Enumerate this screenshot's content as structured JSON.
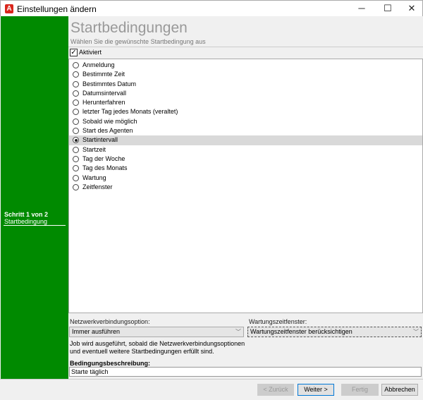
{
  "window": {
    "title": "Einstellungen ändern",
    "icon": "A",
    "minimize": "─",
    "maximize": "☐",
    "close": "✕"
  },
  "sidebar": {
    "step": "Schritt 1 von 2",
    "step_name": "Startbedingung",
    "color": "#008a00"
  },
  "header": {
    "title": "Startbedingungen",
    "subtitle": "Wählen Sie die gewünschte Startbedingung aus"
  },
  "enabled": {
    "label": "Aktiviert",
    "checked": true
  },
  "conditions": [
    {
      "label": "Anmeldung",
      "selected": false
    },
    {
      "label": "Bestimmte Zeit",
      "selected": false
    },
    {
      "label": "Bestimmtes Datum",
      "selected": false
    },
    {
      "label": "Datumsintervall",
      "selected": false
    },
    {
      "label": "Herunterfahren",
      "selected": false
    },
    {
      "label": "letzter Tag jedes Monats (veraltet)",
      "selected": false
    },
    {
      "label": "Sobald wie möglich",
      "selected": false
    },
    {
      "label": "Start des Agenten",
      "selected": false
    },
    {
      "label": "Startintervall",
      "selected": true
    },
    {
      "label": "Startzeit",
      "selected": false
    },
    {
      "label": "Tag der Woche",
      "selected": false
    },
    {
      "label": "Tag des Monats",
      "selected": false
    },
    {
      "label": "Wartung",
      "selected": false
    },
    {
      "label": "Zeitfenster",
      "selected": false
    }
  ],
  "network": {
    "label": "Netzwerkverbindungsoption:",
    "value": "Immer ausführen"
  },
  "maintenance": {
    "label": "Wartungszeitfenster:",
    "value": "Wartungszeitfenster berücksichtigen"
  },
  "description_text": "Job wird ausgeführt, sobald die Netzwerkverbindungsoptionen und eventuell weitere Startbedingungen erfüllt sind.",
  "condition_description": {
    "label": "Bedingungsbeschreibung:",
    "value": "Starte täglich"
  },
  "buttons": {
    "back": "< Zurück",
    "next": "Weiter >",
    "finish": "Fertig",
    "cancel": "Abbrechen"
  }
}
